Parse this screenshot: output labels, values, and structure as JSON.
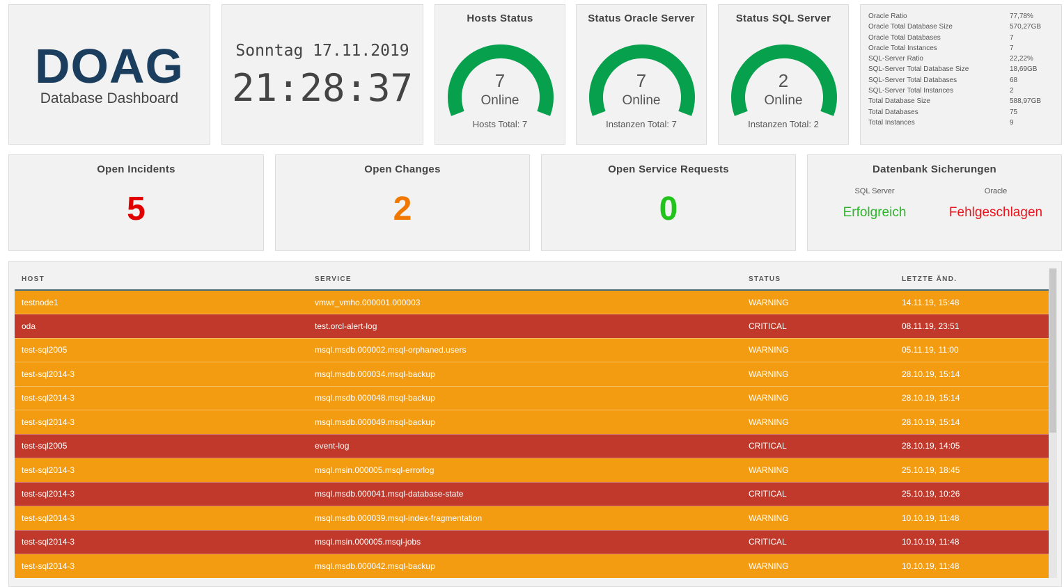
{
  "logo": {
    "title": "DOAG",
    "subtitle": "Database Dashboard"
  },
  "clock": {
    "date": "Sonntag 17.11.2019",
    "time": "21:28:37"
  },
  "gauges": [
    {
      "title": "Hosts Status",
      "value": "7",
      "label": "Online",
      "total": "Hosts Total: 7",
      "fraction": 1.0
    },
    {
      "title": "Status Oracle Server",
      "value": "7",
      "label": "Online",
      "total": "Instanzen Total: 7",
      "fraction": 1.0
    },
    {
      "title": "Status SQL Server",
      "value": "2",
      "label": "Online",
      "total": "Instanzen Total: 2",
      "fraction": 1.0
    }
  ],
  "stats": [
    {
      "key": "Oracle Ratio",
      "value": "77,78%"
    },
    {
      "key": "Oracle Total Database Size",
      "value": "570,27GB"
    },
    {
      "key": "Oracle Total Databases",
      "value": "7"
    },
    {
      "key": "Oracle Total Instances",
      "value": "7"
    },
    {
      "key": "SQL-Server Ratio",
      "value": "22,22%"
    },
    {
      "key": "SQL-Server Total Database Size",
      "value": "18,69GB"
    },
    {
      "key": "SQL-Server Total Databases",
      "value": "68"
    },
    {
      "key": "SQL-Server Total Instances",
      "value": "2"
    },
    {
      "key": "Total Database Size",
      "value": "588,97GB"
    },
    {
      "key": "Total Databases",
      "value": "75"
    },
    {
      "key": "Total Instances",
      "value": "9"
    }
  ],
  "kpis": [
    {
      "title": "Open Incidents",
      "value": "5",
      "color": "#e10000"
    },
    {
      "title": "Open Changes",
      "value": "2",
      "color": "#f07800"
    },
    {
      "title": "Open Service Requests",
      "value": "0",
      "color": "#22c41c"
    }
  ],
  "backups": {
    "title": "Datenbank Sicherungen",
    "items": [
      {
        "name": "SQL Server",
        "status": "Erfolgreich",
        "color": "#2ab52a"
      },
      {
        "name": "Oracle",
        "status": "Fehlgeschlagen",
        "color": "#e8141c"
      }
    ]
  },
  "colors": {
    "gauge": "#07a14e",
    "warning": "#f39c12",
    "critical": "#c0392b"
  },
  "table": {
    "headers": [
      "HOST",
      "SERVICE",
      "STATUS",
      "LETZTE ÄND."
    ],
    "rows": [
      {
        "host": "testnode1",
        "service": "vmwr_vmho.000001.000003",
        "status": "WARNING",
        "changed": "14.11.19, 15:48"
      },
      {
        "host": "oda",
        "service": "test.orcl-alert-log",
        "status": "CRITICAL",
        "changed": "08.11.19, 23:51"
      },
      {
        "host": "test-sql2005",
        "service": "msql.msdb.000002.msql-orphaned.users",
        "status": "WARNING",
        "changed": "05.11.19, 11:00"
      },
      {
        "host": "test-sql2014-3",
        "service": "msql.msdb.000034.msql-backup",
        "status": "WARNING",
        "changed": "28.10.19, 15:14"
      },
      {
        "host": "test-sql2014-3",
        "service": "msql.msdb.000048.msql-backup",
        "status": "WARNING",
        "changed": "28.10.19, 15:14"
      },
      {
        "host": "test-sql2014-3",
        "service": "msql.msdb.000049.msql-backup",
        "status": "WARNING",
        "changed": "28.10.19, 15:14"
      },
      {
        "host": "test-sql2005",
        "service": "event-log",
        "status": "CRITICAL",
        "changed": "28.10.19, 14:05"
      },
      {
        "host": "test-sql2014-3",
        "service": "msql.msin.000005.msql-errorlog",
        "status": "WARNING",
        "changed": "25.10.19, 18:45"
      },
      {
        "host": "test-sql2014-3",
        "service": "msql.msdb.000041.msql-database-state",
        "status": "CRITICAL",
        "changed": "25.10.19, 10:26"
      },
      {
        "host": "test-sql2014-3",
        "service": "msql.msdb.000039.msql-index-fragmentation",
        "status": "WARNING",
        "changed": "10.10.19, 11:48"
      },
      {
        "host": "test-sql2014-3",
        "service": "msql.msin.000005.msql-jobs",
        "status": "CRITICAL",
        "changed": "10.10.19, 11:48"
      },
      {
        "host": "test-sql2014-3",
        "service": "msql.msdb.000042.msql-backup",
        "status": "WARNING",
        "changed": "10.10.19, 11:48"
      }
    ]
  }
}
